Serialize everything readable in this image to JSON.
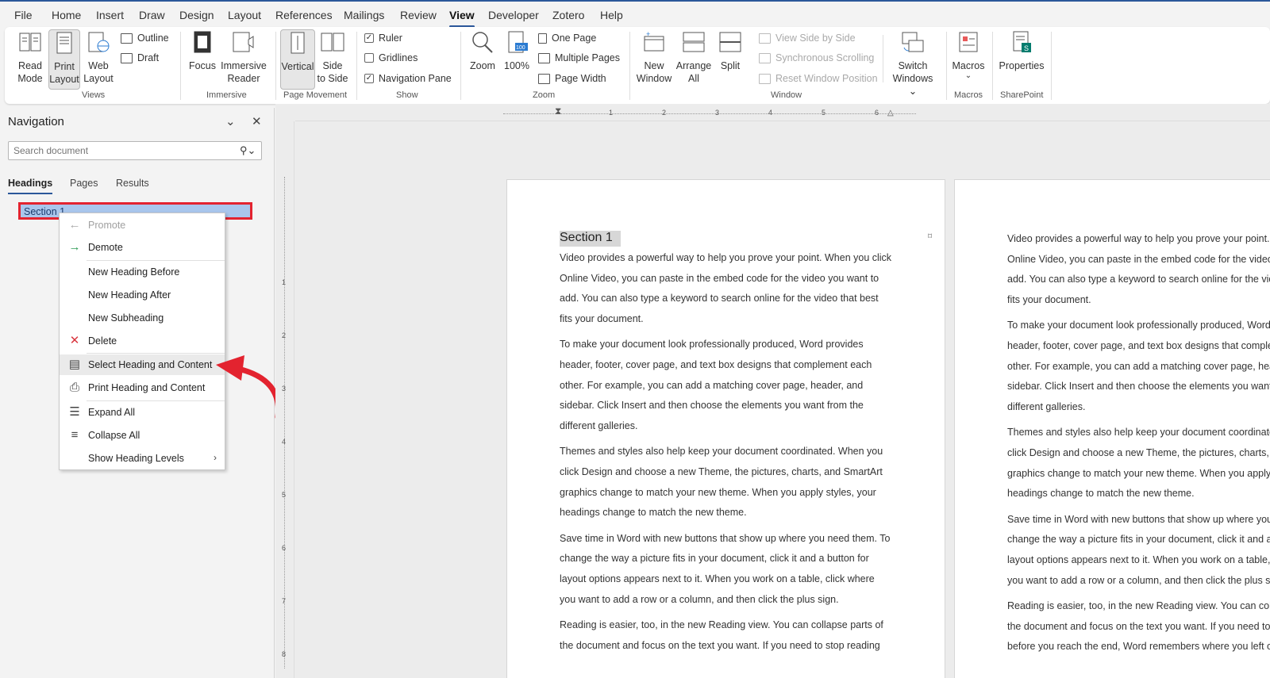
{
  "menubar": {
    "tabs": [
      "File",
      "Home",
      "Insert",
      "Draw",
      "Design",
      "Layout",
      "References",
      "Mailings",
      "Review",
      "View",
      "Developer",
      "Zotero",
      "Help"
    ],
    "active": "View"
  },
  "ribbon": {
    "views": {
      "read_mode": [
        "Read",
        "Mode"
      ],
      "print_layout": [
        "Print",
        "Layout"
      ],
      "web_layout": [
        "Web",
        "Layout"
      ],
      "outline": "Outline",
      "draft": "Draft",
      "label": "Views"
    },
    "immersive": {
      "focus": "Focus",
      "immersive_reader": [
        "Immersive",
        "Reader"
      ],
      "label": "Immersive"
    },
    "page_movement": {
      "vertical": "Vertical",
      "side_to_side": [
        "Side",
        "to Side"
      ],
      "label": "Page Movement"
    },
    "show": {
      "ruler": "Ruler",
      "gridlines": "Gridlines",
      "navigation_pane": "Navigation Pane",
      "label": "Show",
      "ruler_checked": true,
      "gridlines_checked": false,
      "nav_checked": true
    },
    "zoom": {
      "zoom": "Zoom",
      "hundred": "100%",
      "one_page": "One Page",
      "multiple_pages": "Multiple Pages",
      "page_width": "Page Width",
      "label": "Zoom"
    },
    "window": {
      "new_window": [
        "New",
        "Window"
      ],
      "arrange_all": [
        "Arrange",
        "All"
      ],
      "split": "Split",
      "view_side_by_side": "View Side by Side",
      "sync_scrolling": "Synchronous Scrolling",
      "reset_position": "Reset Window Position",
      "switch_windows": [
        "Switch",
        "Windows ⌄"
      ],
      "label": "Window"
    },
    "macros": {
      "macros": "Macros",
      "label": "Macros"
    },
    "sharepoint": {
      "properties": "Properties",
      "label": "SharePoint"
    }
  },
  "nav": {
    "title": "Navigation",
    "search_placeholder": "Search document",
    "tabs": [
      "Headings",
      "Pages",
      "Results"
    ],
    "active_tab": "Headings",
    "heading": "Section 1"
  },
  "context_menu": {
    "items": [
      {
        "label": "Promote",
        "icon": "arrow-left-icon",
        "disabled": true
      },
      {
        "label": "Demote",
        "icon": "arrow-right-icon",
        "disabled": false
      },
      {
        "label": "New Heading Before",
        "icon": "",
        "disabled": false
      },
      {
        "label": "New Heading After",
        "icon": "",
        "disabled": false
      },
      {
        "label": "New Subheading",
        "icon": "",
        "disabled": false
      },
      {
        "label": "Delete",
        "icon": "delete-x-icon",
        "disabled": false
      },
      {
        "label": "Select Heading and Content",
        "icon": "select-heading-icon",
        "disabled": false
      },
      {
        "label": "Print Heading and Content",
        "icon": "printer-icon",
        "disabled": false
      },
      {
        "label": "Expand All",
        "icon": "expand-all-icon",
        "disabled": false
      },
      {
        "label": "Collapse All",
        "icon": "collapse-all-icon",
        "disabled": false
      },
      {
        "label": "Show Heading Levels",
        "icon": "",
        "disabled": false
      }
    ]
  },
  "ruler": {
    "h_marks": [
      "1",
      "2",
      "3",
      "4",
      "5",
      "6"
    ],
    "v_marks": [
      "1",
      "2",
      "3",
      "4",
      "5",
      "6",
      "7",
      "8"
    ]
  },
  "document": {
    "heading": "Section 1",
    "page1_paragraphs": [
      "Video provides a powerful way to help you prove your point. When you click Online Video, you can paste in the embed code for the video you want to add. You can also type a keyword to search online for the video that best fits your document.",
      "To make your document look professionally produced, Word provides header, footer, cover page, and text box designs that complement each other. For example, you can add a matching cover page, header, and sidebar. Click Insert and then choose the elements you want from the different galleries.",
      "Themes and styles also help keep your document coordinated. When you click Design and choose a new Theme, the pictures, charts, and SmartArt graphics change to match your new theme. When you apply styles, your headings change to match the new theme.",
      "Save time in Word with new buttons that show up where you need them. To change the way a picture fits in your document, click it and a button for layout options appears next to it. When you work on a table, click where you want to add a row or a column, and then click the plus sign.",
      "Reading is easier, too, in the new Reading view. You can collapse parts of the document and focus on the text you want. If you need to stop reading"
    ],
    "page2_paragraphs": [
      "Video provides a powerful way to help you prove your point. When you click Online Video, you can paste in the embed code for the video you want to add. You can also type a keyword to search online for the video that best fits your document.",
      "To make your document look professionally produced, Word provides header, footer, cover page, and text box designs that complement each other. For example, you can add a matching cover page, header, and sidebar. Click Insert and then choose the elements you want from the different galleries.",
      "Themes and styles also help keep your document coordinated. When you click Design and choose a new Theme, the pictures, charts, and SmartArt graphics change to match your new theme. When you apply styles, your headings change to match the new theme.",
      "Save time in Word with new buttons that show up where you need them. To change the way a picture fits in your document, click it and a button for layout options appears next to it. When you work on a table, click where you want to add a row or a column, and then click the plus sign.",
      "Reading is easier, too, in the new Reading view. You can collapse parts of the document and focus on the text you want. If you need to stop reading before you reach the end, Word remembers where you left off."
    ]
  },
  "colors": {
    "accent": "#2b579a",
    "highlight_border": "#e3232f",
    "annotation_arrow": "#e3232f",
    "selected_heading": "#a9c6ec"
  }
}
